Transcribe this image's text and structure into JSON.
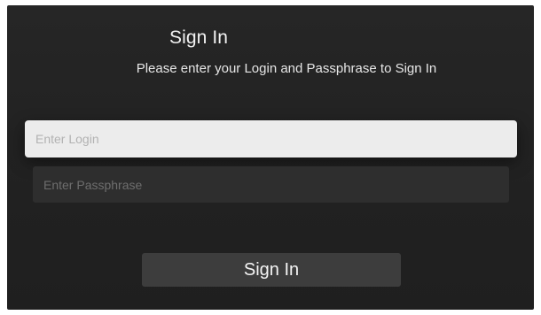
{
  "header": {
    "title": "Sign In",
    "subtitle": "Please enter your Login and Passphrase to Sign In"
  },
  "form": {
    "login": {
      "value": "",
      "placeholder": "Enter Login"
    },
    "passphrase": {
      "value": "",
      "placeholder": "Enter Passphrase"
    },
    "submit_label": "Sign In"
  },
  "colors": {
    "background": "#222222",
    "focused_field": "#ececec",
    "unfocused_field": "#2e2e2e",
    "button": "#3d3d3d",
    "text": "#f2f2f2"
  }
}
